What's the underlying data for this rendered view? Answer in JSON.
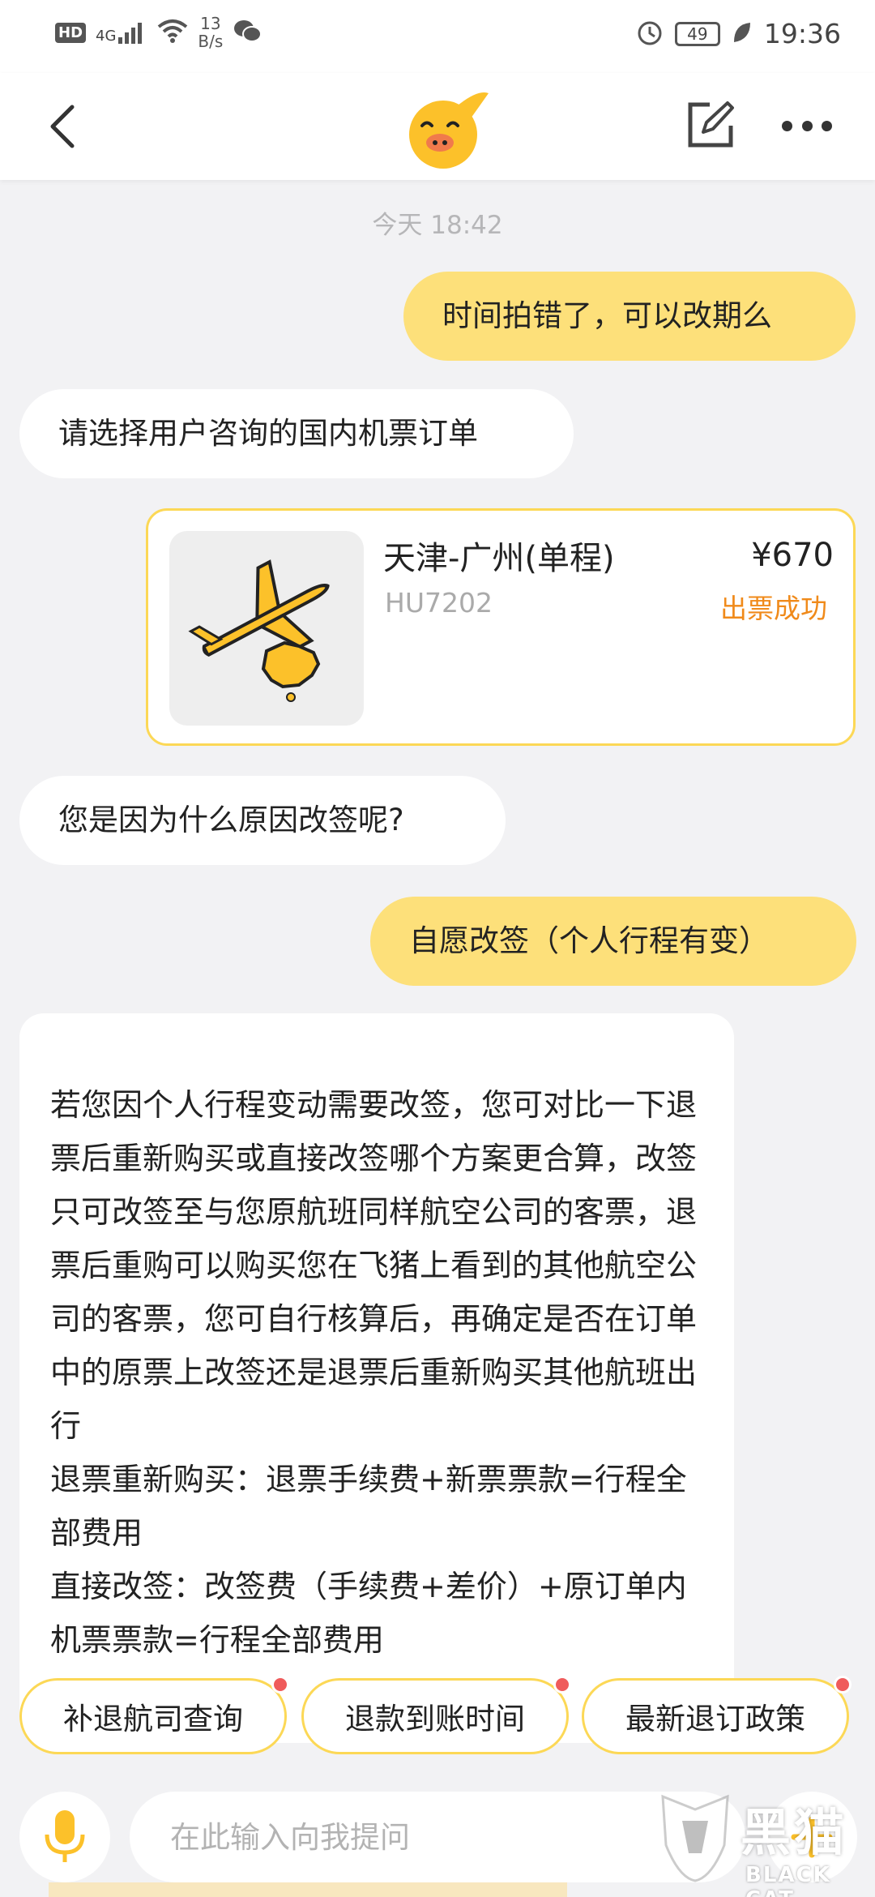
{
  "status_bar": {
    "network_badge": "HD",
    "signal": "4G",
    "speed_value": "13",
    "speed_unit": "B/s",
    "battery": "49",
    "time": "19:36"
  },
  "header": {
    "back_icon": "chevron-left-icon",
    "logo_icon": "fliggy-pig-logo",
    "edit_icon": "edit-icon",
    "more_icon": "more-icon"
  },
  "chat": {
    "timestamp": "今天 18:42",
    "messages": [
      {
        "from": "user",
        "text": "时间拍错了，可以改期么"
      },
      {
        "from": "bot",
        "text": "请选择用户咨询的国内机票订单"
      },
      {
        "from": "bot",
        "text": "您是因为什么原因改签呢?"
      },
      {
        "from": "user",
        "text": "自愿改签（个人行程有变）"
      }
    ],
    "order_card": {
      "route": "天津-广州(单程)",
      "flight_no": "HU7202",
      "price": "¥670",
      "status": "出票成功"
    },
    "long_message": {
      "paragraphs": [
        "若您因个人行程变动需要改签，您可对比一下退票后重新购买或直接改签哪个方案更合算，改签只可改签至与您原航班同样航空公司的客票，退票后重购可以购买您在飞猪上看到的其他航空公司的客票，您可自行核算后，再确定是否在订单中的原票上改签还是退票后重新购买其他航班出行",
        "退票重新购买：退票手续费+新票票款=行程全部费用",
        "直接改签：改签费（手续费+差价）+原订单内机票票款=行程全部费用"
      ]
    }
  },
  "quick_chips": [
    {
      "label": "补退航司查询"
    },
    {
      "label": "退款到账时间"
    },
    {
      "label": "最新退订政策"
    }
  ],
  "input_bar": {
    "placeholder": "在此输入向我提问",
    "mic_icon": "microphone-icon",
    "plus_icon": "plus-icon"
  },
  "watermark": {
    "text": "黑猫",
    "sub": "BLACK CAT"
  },
  "colors": {
    "accent_yellow": "#fde07a",
    "border_yellow": "#fcd856",
    "status_orange": "#f08a1a",
    "badge_red": "#ef5b5b"
  }
}
